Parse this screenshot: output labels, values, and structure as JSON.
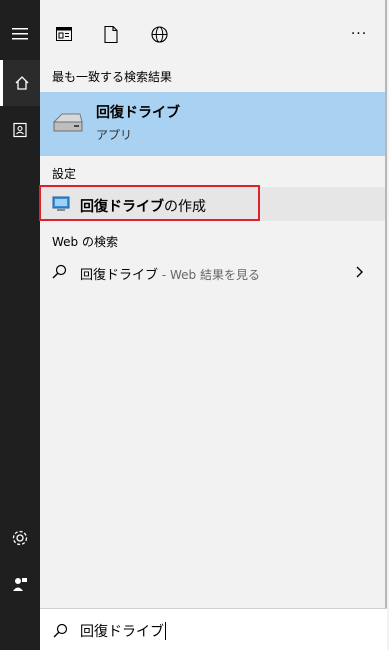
{
  "rail": {
    "icons": [
      "hamburger-icon",
      "home-icon",
      "notebook-icon",
      "settings-icon",
      "user-feedback-icon"
    ]
  },
  "toolbar": {
    "icons": [
      "apps-icon",
      "documents-icon",
      "web-icon",
      "more-icon"
    ],
    "more_label": "···"
  },
  "best_match": {
    "heading": "最も一致する検索結果",
    "title": "回復ドライブ",
    "subtitle": "アプリ",
    "icon": "drive-icon"
  },
  "settings": {
    "heading": "設定",
    "item_bold": "回復ドライブ",
    "item_rest": "の作成",
    "icon": "monitor-icon"
  },
  "web": {
    "heading": "Web の検索",
    "query": "回復ドライブ",
    "suffix": " - Web 結果を見る",
    "icon": "search-icon",
    "chevron": "chevron-right-icon"
  },
  "search": {
    "value": "回復ドライブ",
    "icon": "search-icon"
  },
  "colors": {
    "rail_bg": "#1f1f1f",
    "selected_bg": "#a9d1f1",
    "highlight_border": "#e0202a"
  }
}
